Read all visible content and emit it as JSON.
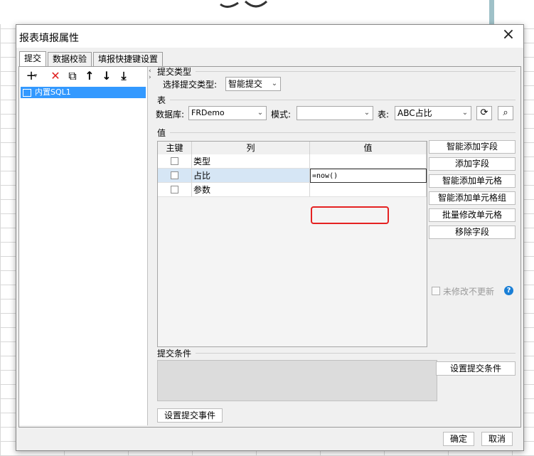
{
  "dialog": {
    "title": "报表填报属性",
    "close_symbol": "×"
  },
  "tabs": [
    {
      "label": "提交",
      "active": true
    },
    {
      "label": "数据校验",
      "active": false
    },
    {
      "label": "填报快捷键设置",
      "active": false
    }
  ],
  "toolbar": {
    "add": "+",
    "add_dropdown": "▾",
    "delete": "✕",
    "copy": "⧉",
    "up": "↑",
    "down": "↓",
    "bottom": "⤓"
  },
  "tree": {
    "items": [
      {
        "label": "内置SQL1",
        "selected": true
      }
    ]
  },
  "submit_type": {
    "section": "提交类型",
    "label": "选择提交类型:",
    "value": "智能提交"
  },
  "table_section": {
    "section": "表",
    "db_label": "数据库:",
    "db_value": "FRDemo",
    "schema_label": "模式:",
    "schema_value": "",
    "table_label": "表:",
    "table_value": "ABC占比",
    "refresh_icon": "⟳",
    "preview_icon": "⌕"
  },
  "value_section": {
    "section": "值",
    "columns": [
      "主键",
      "列",
      "值"
    ],
    "rows": [
      {
        "key": false,
        "col": "类型",
        "val": ""
      },
      {
        "key": false,
        "col": "占比",
        "val": "=now()",
        "selected": true
      },
      {
        "key": false,
        "col": "参数",
        "val": ""
      }
    ]
  },
  "side_buttons": [
    "智能添加字段",
    "添加字段",
    "智能添加单元格",
    "智能添加单元格组",
    "批量修改单元格",
    "移除字段"
  ],
  "unmodified_checkbox": {
    "label": "未修改不更新",
    "checked": false,
    "enabled": false
  },
  "help_icon": "?",
  "conditions": {
    "section": "提交条件",
    "button": "设置提交条件"
  },
  "event_button": "设置提交事件",
  "footer": {
    "ok": "确定",
    "cancel": "取消"
  },
  "colors": {
    "accent": "#3399ff",
    "highlight": "#e52222",
    "help": "#1a7fd6"
  }
}
